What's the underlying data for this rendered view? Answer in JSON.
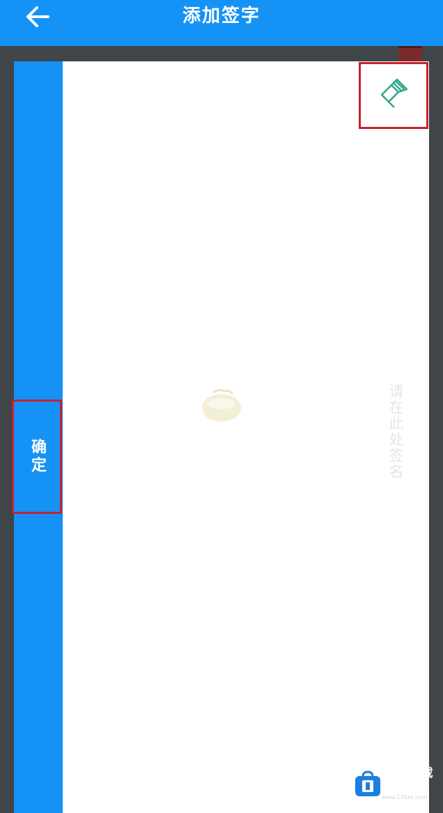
{
  "header": {
    "title": "添加签字",
    "back_icon": "arrow-left-icon"
  },
  "sidebar": {
    "confirm_label": "确定"
  },
  "canvas": {
    "clear_icon": "eraser-icon",
    "hint": "请在此处签名"
  },
  "watermark": {
    "brand": "176下载网",
    "domain": "www.176xz.com",
    "logo_icon": "bag-logo-icon"
  },
  "colors": {
    "primary": "#1592f5",
    "highlight_border": "#c8202f",
    "background": "#3f4549",
    "eraser": "#2fa58a"
  }
}
